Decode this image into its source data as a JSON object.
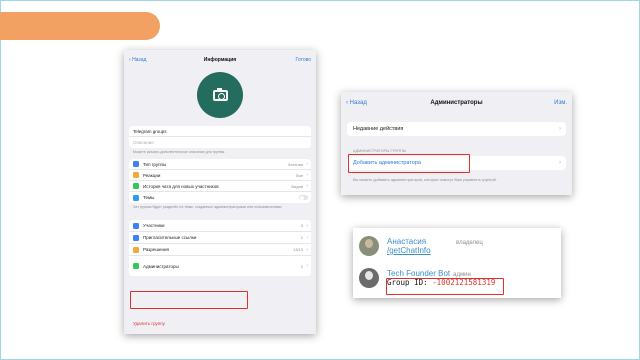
{
  "info_screen": {
    "back": "Назад",
    "title": "Информация",
    "done": "Готово",
    "group_name": "Telegram groups",
    "description_placeholder": "Описание",
    "description_hint": "Можете указать дополнительное описание для группы.",
    "rows": [
      {
        "label": "Тип группы",
        "value": "Частная",
        "icon_color": "#3b82f6"
      },
      {
        "label": "Реакции",
        "value": "Все",
        "icon_color": "#f2a93b"
      },
      {
        "label": "История чата для новых участников",
        "value": "Видна",
        "icon_color": "#34c759"
      },
      {
        "label": "Темы",
        "value": "",
        "icon_color": "#2e9cf0"
      }
    ],
    "topics_hint": "Чат группы будет разделён на темы, созданные администраторами или пользователями.",
    "members_rows": [
      {
        "label": "Участники",
        "value": "3",
        "icon_color": "#3b82f6"
      },
      {
        "label": "Пригласительные ссылки",
        "value": "1",
        "icon_color": "#3b82f6"
      },
      {
        "label": "Разрешения",
        "value": "13/13",
        "icon_color": "#f2a93b"
      },
      {
        "label": "Администраторы",
        "value": "2",
        "icon_color": "#34c759"
      }
    ],
    "delete_group": "Удалить группу"
  },
  "admins_screen": {
    "back": "Назад",
    "title": "Администраторы",
    "edit": "Изм.",
    "recent_actions": "Недавние действия",
    "section_header": "АДМИНИСТРАТОРЫ ГРУППЫ",
    "add_admin": "Добавить администратора",
    "hint": "Вы можете добавить администраторов, которые помогут Вам управлять группой."
  },
  "chat_snippet": {
    "user_name": "Анастасия",
    "user_role": "владелец",
    "command": "/getChatInfo",
    "bot_name": "Tech Founder Bot",
    "bot_role": "админ",
    "group_id_label": "Group ID:",
    "group_id_value": "-1002121581319"
  },
  "colors": {
    "accent_orange": "#f3a162",
    "avatar_green": "#246d5e",
    "highlight_red": "#e0302a",
    "link_blue": "#2e7dd1"
  }
}
